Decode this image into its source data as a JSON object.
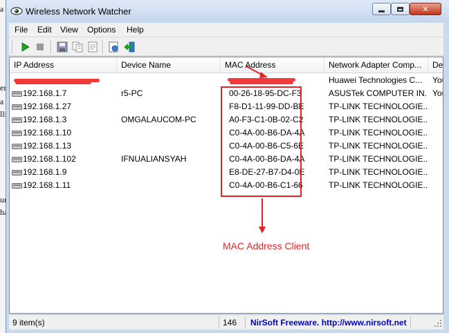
{
  "window": {
    "title": "Wireless Network Watcher",
    "controls": [
      "minimize-icon",
      "maximize-icon",
      "close-icon"
    ]
  },
  "background_doc": {
    "chars": [
      "a",
      "er",
      "a",
      "lli",
      "ur",
      "ha"
    ]
  },
  "menu": {
    "items": [
      {
        "label": "File"
      },
      {
        "label": "Edit"
      },
      {
        "label": "View"
      },
      {
        "label": "Options"
      },
      {
        "label": "Help"
      }
    ]
  },
  "toolbar": {
    "buttons": [
      "start-scan-icon",
      "stop-scan-icon",
      "save-icon",
      "copy-icon",
      "properties-icon",
      "html-report-icon",
      "exit-icon"
    ]
  },
  "table": {
    "columns": [
      "IP Address",
      "Device Name",
      "MAC Address",
      "Network Adapter Comp...",
      "Dev"
    ],
    "rows": [
      {
        "ip": "",
        "device": "",
        "mac": "",
        "adapter": "Huawei Technologies C...",
        "dev": "You",
        "redacted": true
      },
      {
        "ip": "192.168.1.7",
        "device": "r5-PC",
        "mac": "00-26-18-95-DC-F3",
        "adapter": "ASUSTek COMPUTER IN...",
        "dev": "You"
      },
      {
        "ip": "192.168.1.27",
        "device": "",
        "mac": "F8-D1-11-99-DD-BE",
        "adapter": "TP-LINK TECHNOLOGIE...",
        "dev": ""
      },
      {
        "ip": "192.168.1.3",
        "device": "OMGALAUCOM-PC",
        "mac": "A0-F3-C1-0B-02-C2",
        "adapter": "TP-LINK TECHNOLOGIE...",
        "dev": ""
      },
      {
        "ip": "192.168.1.10",
        "device": "",
        "mac": "C0-4A-00-B6-DA-4A",
        "adapter": "TP-LINK TECHNOLOGIE...",
        "dev": ""
      },
      {
        "ip": "192.168.1.13",
        "device": "",
        "mac": "C0-4A-00-B6-C5-6E",
        "adapter": "TP-LINK TECHNOLOGIE...",
        "dev": ""
      },
      {
        "ip": "192.168.1.102",
        "device": "IFNUALIANSYAH",
        "mac": "C0-4A-00-B6-DA-4A",
        "adapter": "TP-LINK TECHNOLOGIE...",
        "dev": ""
      },
      {
        "ip": "192.168.1.9",
        "device": "",
        "mac": "E8-DE-27-B7-D4-0E",
        "adapter": "TP-LINK TECHNOLOGIE...",
        "dev": ""
      },
      {
        "ip": "192.168.1.11",
        "device": "",
        "mac": "C0-4A-00-B6-C1-66",
        "adapter": "TP-LINK TECHNOLOGIE...",
        "dev": ""
      }
    ]
  },
  "annotation": {
    "label": "MAC Address Client",
    "color": "#e52222"
  },
  "status": {
    "items_count": "9 item(s)",
    "number": "146",
    "credit": "NirSoft Freeware.  http://www.nirsoft.net"
  }
}
